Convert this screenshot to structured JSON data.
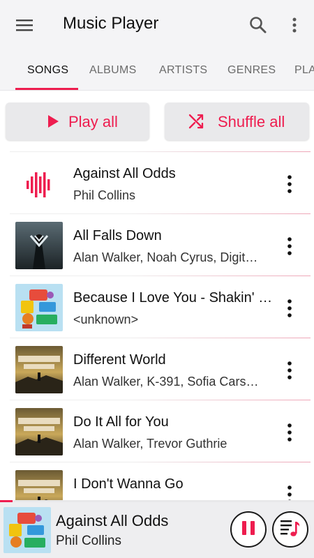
{
  "app": {
    "title": "Music Player"
  },
  "appbar": {
    "menu_icon": "hamburger-menu-icon",
    "search_icon": "search-icon",
    "more_icon": "more-vertical-icon"
  },
  "tabs": [
    {
      "label": "SONGS",
      "active": true
    },
    {
      "label": "ALBUMS",
      "active": false
    },
    {
      "label": "ARTISTS",
      "active": false
    },
    {
      "label": "GENRES",
      "active": false
    },
    {
      "label": "PLA",
      "active": false
    }
  ],
  "actions": {
    "play_all": "Play all",
    "shuffle_all": "Shuffle all"
  },
  "songs": [
    {
      "title": "Against All Odds",
      "artist": "Phil Collins",
      "art": "now-playing-bars"
    },
    {
      "title": "All Falls Down",
      "artist": "Alan Walker, Noah Cyrus, Digit…",
      "art": "dark-hooded-figure"
    },
    {
      "title": "Because I Love You - Shakin' …",
      "artist": "<unknown>",
      "art": "colorful-collage"
    },
    {
      "title": "Different World",
      "artist": "Alan Walker, K-391, Sofia Cars…",
      "art": "different-world-cover"
    },
    {
      "title": "Do It All for You",
      "artist": "Alan Walker, Trevor Guthrie",
      "art": "different-world-cover"
    },
    {
      "title": "I Don't Wanna Go",
      "artist": "",
      "art": "different-world-cover"
    }
  ],
  "now_playing": {
    "title": "Against All Odds",
    "artist": "Phil Collins",
    "progress": 0.04
  },
  "colors": {
    "accent": "#ee1d4f",
    "appbar": "#f4f4f6",
    "player": "#eeeef0"
  }
}
